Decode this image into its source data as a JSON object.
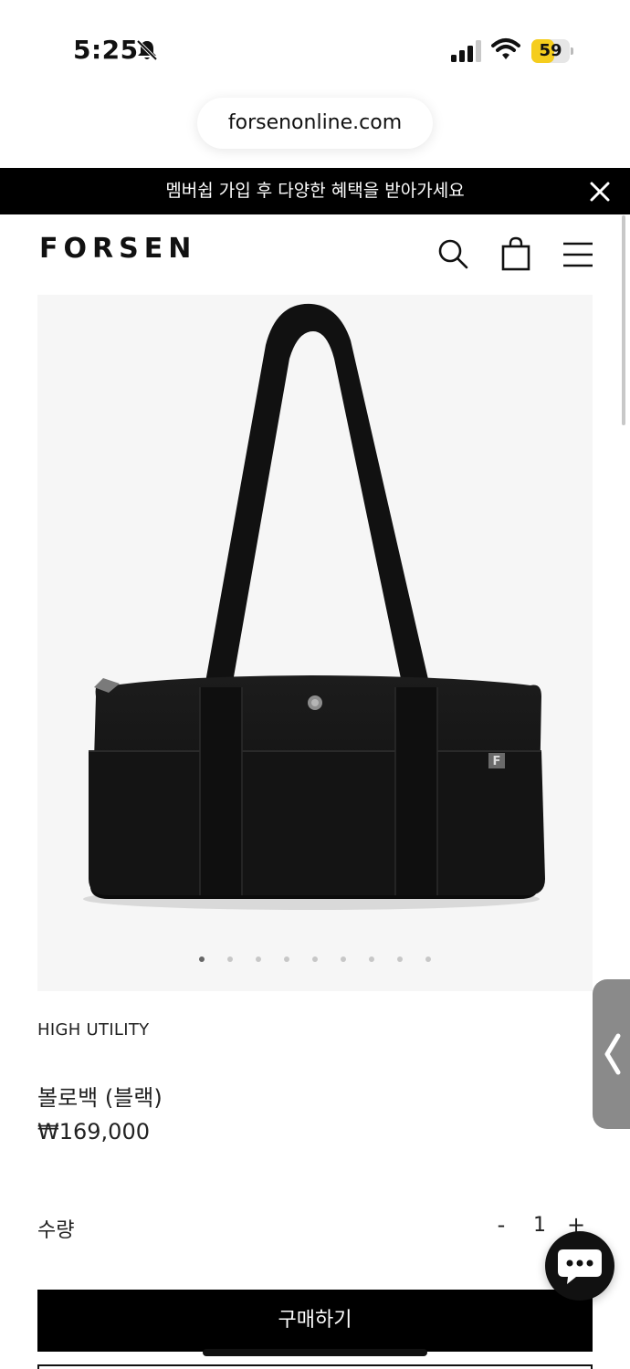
{
  "status_bar": {
    "time": "5:25",
    "battery": "59",
    "battery_level_percent": 59,
    "icons": [
      "bell-slash-icon",
      "cellular-signal-icon",
      "wifi-icon",
      "battery-icon"
    ]
  },
  "browser": {
    "url": "forsenonline.com"
  },
  "promo_banner": {
    "text": "멤버쉽 가입 후 다양한 혜택을 받아가세요",
    "close_icon": "close-icon"
  },
  "header": {
    "logo": "FORSEN",
    "icons": [
      "search-icon",
      "shopping-bag-icon",
      "hamburger-menu-icon"
    ]
  },
  "carousel": {
    "total_slides": 9,
    "active_index": 0
  },
  "product": {
    "brand": "HIGH UTILITY",
    "name": "볼로백 (블랙)",
    "price": "₩169,000"
  },
  "quantity": {
    "label": "수량",
    "minus": "-",
    "value": "1",
    "plus": "+"
  },
  "actions": {
    "buy_label": "구매하기"
  },
  "floating": {
    "side_tab_icon": "chevron-left-icon",
    "chat_icon": "chat-bubble-icon"
  },
  "colors": {
    "banner_bg": "#000000",
    "battery_fill": "#f5cd1d",
    "button_bg": "#000000"
  }
}
